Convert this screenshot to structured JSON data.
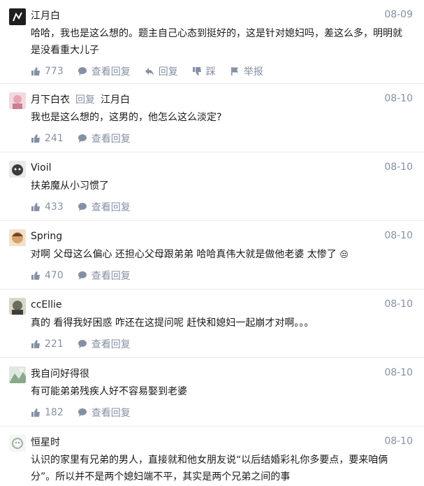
{
  "comments": [
    {
      "author": "江月白",
      "reply_to": "",
      "date": "08-09",
      "text": "哈哈，我也是这么想的。题主自己心态到挺好的，这是针对媳妇吗，差这么多，明明就是没看重大儿子",
      "likes": "773",
      "view_replies": "查看回复",
      "reply": "回复",
      "dislike": "踩",
      "report": "举报",
      "avatar_color": "#1f1f1f"
    },
    {
      "author": "月下白衣",
      "reply_kw": "回复",
      "reply_to": "江月白",
      "date": "08-10",
      "text": "我也是这么想的，这男的，他怎么这么淡定?",
      "likes": "241",
      "view_replies": "查看回复",
      "avatar_color": "#e8a6b5"
    },
    {
      "author": "Vioil",
      "reply_to": "",
      "date": "08-10",
      "text": "扶弟魔从小习惯了",
      "likes": "433",
      "view_replies": "查看回复",
      "avatar_color": "#3b3b3b"
    },
    {
      "author": "Spring",
      "reply_to": "",
      "date": "08-10",
      "text": "对啊 父母这么偏心 还担心父母跟弟弟 哈哈真伟大就是做他老婆 太惨了",
      "likes": "470",
      "view_replies": "查看回复",
      "avatar_color": "#d7a16a",
      "emoji": "😒"
    },
    {
      "author": "ccEllie",
      "reply_to": "",
      "date": "08-10",
      "text": "真的 看得我好困惑 咋还在这提问呢 赶快和媳妇一起崩才对啊。。。",
      "likes": "221",
      "view_replies": "查看回复",
      "avatar_color": "#6b6b5e"
    },
    {
      "author": "我自问好得很",
      "reply_to": "",
      "date": "08-10",
      "text": "有可能弟弟残疾人好不容易娶到老婆",
      "likes": "182",
      "view_replies": "查看回复",
      "avatar_color": "#8aa98a"
    },
    {
      "author": "恒星时",
      "reply_to": "",
      "date": "08-10",
      "text": "认识的家里有兄弟的男人，直接就和他女朋友说“以后结婚彩礼你多要点，要来咱俩分”。所以并不是两个媳妇端不平，其实是两个兄弟之间的事",
      "avatar_color": "#cfd8d0"
    }
  ]
}
